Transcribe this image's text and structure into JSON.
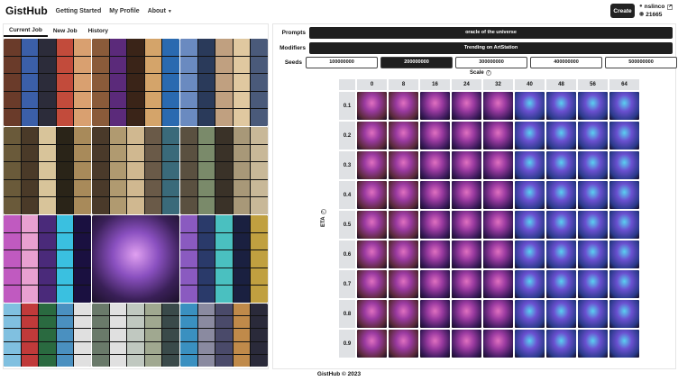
{
  "navbar": {
    "brand": "GistHub",
    "links": [
      "Getting Started",
      "My Profile",
      "About"
    ],
    "create_label": "Create",
    "username": "nslinco",
    "credits": "21665"
  },
  "tabs": [
    "Current Job",
    "New Job",
    "History"
  ],
  "params": {
    "prompts_label": "Prompts",
    "prompt_value": "oracle of the universe",
    "modifiers_label": "Modifiers",
    "modifier_value": "Trending on ArtStation",
    "seeds_label": "Seeds",
    "seeds": [
      "100000000",
      "200000000",
      "300000000",
      "400000000",
      "500000000"
    ],
    "selected_seed": 1
  },
  "grid": {
    "scale_label": "Scale",
    "eta_label": "ETA",
    "columns": [
      "0",
      "8",
      "16",
      "24",
      "32",
      "40",
      "48",
      "56",
      "64"
    ],
    "rows": [
      "0.1",
      "0.2",
      "0.3",
      "0.4",
      "0.5",
      "0.6",
      "0.7",
      "0.8",
      "0.9"
    ]
  },
  "colors": {
    "dark": "#1f1f1f",
    "header_gray": "#dfe1e4",
    "accent_purple": "#7b3fa8",
    "accent_cyan": "#3fc4e0"
  },
  "footer": "GistHub © 2023"
}
